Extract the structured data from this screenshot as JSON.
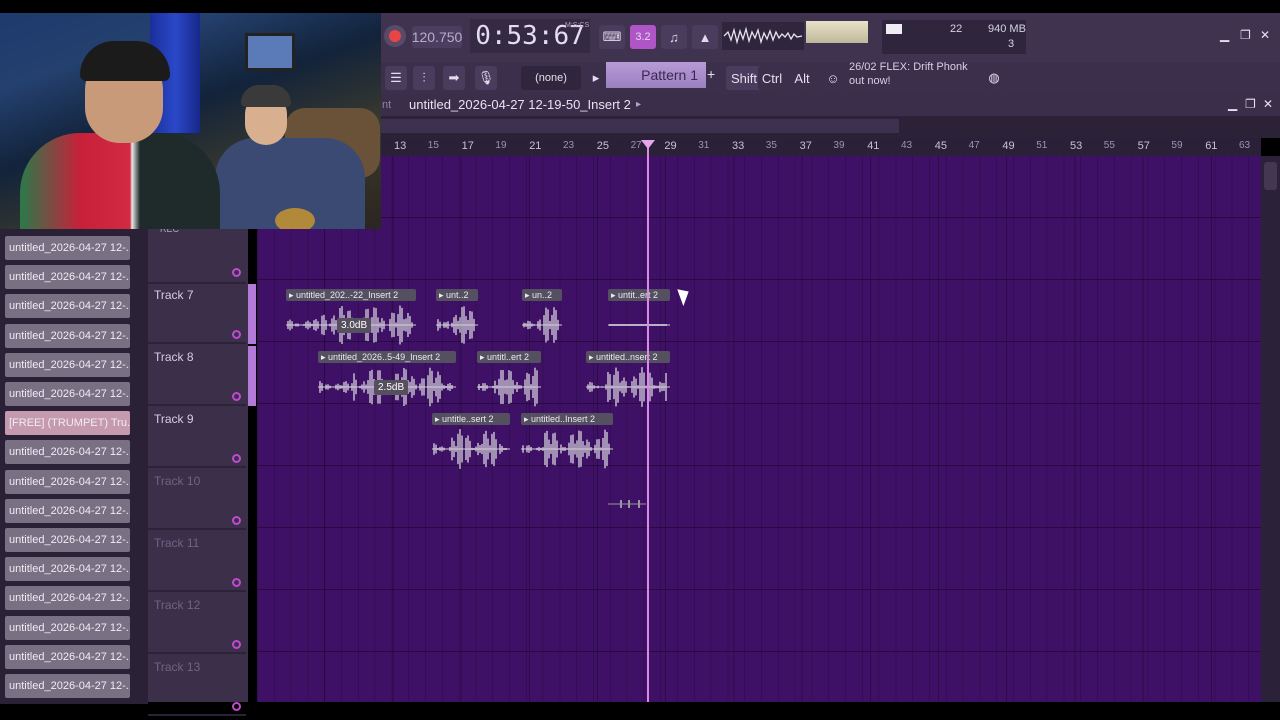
{
  "toolbar": {
    "tempo": "120.750",
    "time": "0:53:67",
    "time_label": "M:S:CS",
    "step_label": "3.2",
    "cpu_value": "22",
    "memory": "940 MB",
    "polyphony": "3",
    "pattern_source": "(none)",
    "pattern": "Pattern 1",
    "shift": "Shift",
    "ctrl": "Ctrl",
    "alt": "Alt",
    "news_date": "26/02",
    "news_title": "FLEX: Drift Phonk",
    "news_sub": "out now!"
  },
  "playlist": {
    "title": "untitled_2026-04-27 12-19-50_Insert 2",
    "title_prefix": "nt",
    "ruler": [
      "13",
      "15",
      "17",
      "19",
      "21",
      "23",
      "25",
      "27",
      "29",
      "31",
      "33",
      "35",
      "37",
      "39",
      "41",
      "43",
      "45",
      "47",
      "49",
      "51",
      "53",
      "55",
      "57",
      "59",
      "61",
      "63"
    ],
    "rec_label": "REC",
    "tracks": [
      "Track 7",
      "Track 8",
      "Track 9",
      "Track 10",
      "Track 11",
      "Track 12",
      "Track 13"
    ],
    "clips": [
      {
        "label": "untitled_202..-22_Insert 2",
        "track": 0
      },
      {
        "label": "unt..2",
        "track": 0
      },
      {
        "label": "un..2",
        "track": 0
      },
      {
        "label": "untit..ert 2",
        "track": 0
      },
      {
        "label": "untitled_2026..5-49_Insert 2",
        "track": 1
      },
      {
        "label": "untitl..ert 2",
        "track": 1
      },
      {
        "label": "untitled..nsert 2",
        "track": 1
      },
      {
        "label": "untitle..sert 2",
        "track": 2
      },
      {
        "label": "untitled..Insert 2",
        "track": 2
      }
    ],
    "gains": [
      "3.0dB",
      "2.5dB"
    ]
  },
  "browser": {
    "items": [
      "untitled_2026-04-27 12-...",
      "untitled_2026-04-27 12-...",
      "untitled_2026-04-27 12-...",
      "untitled_2026-04-27 12-...",
      "untitled_2026-04-27 12-...",
      "untitled_2026-04-27 12-...",
      "[FREE] (TRUMPET) Tru...",
      "untitled_2026-04-27 12-...",
      "untitled_2026-04-27 12-...",
      "untitled_2026-04-27 12-...",
      "untitled_2026-04-27 12-...",
      "untitled_2026-04-27 12-...",
      "untitled_2026-04-27 12-...",
      "untitled_2026-04-27 12-...",
      "untitled_2026-04-27 12-...",
      "untitled_2026-04-27 12-..."
    ]
  }
}
